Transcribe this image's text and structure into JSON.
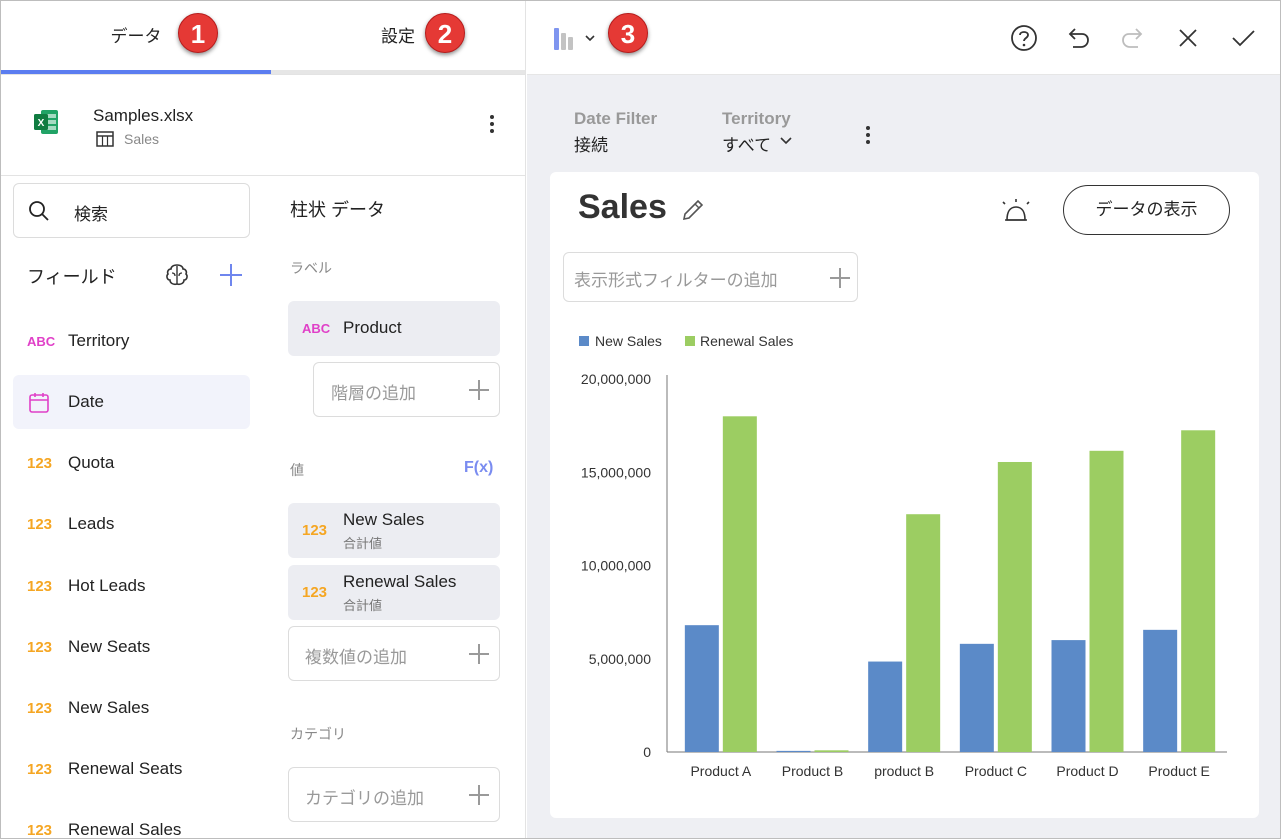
{
  "tabs": {
    "data": "データ",
    "settings": "設定"
  },
  "badges": [
    "1",
    "2",
    "3"
  ],
  "source": {
    "file": "Samples.xlsx",
    "sheet": "Sales"
  },
  "search": {
    "placeholder": "検索"
  },
  "fields": {
    "title": "フィールド",
    "items": [
      {
        "type": "ABC",
        "name": "Territory"
      },
      {
        "type": "date",
        "name": "Date"
      },
      {
        "type": "123",
        "name": "Quota"
      },
      {
        "type": "123",
        "name": "Leads"
      },
      {
        "type": "123",
        "name": "Hot Leads"
      },
      {
        "type": "123",
        "name": "New Seats"
      },
      {
        "type": "123",
        "name": "New Sales"
      },
      {
        "type": "123",
        "name": "Renewal Seats"
      },
      {
        "type": "123",
        "name": "Renewal Sales"
      }
    ]
  },
  "config": {
    "title": "柱状 データ",
    "label_section": "ラベル",
    "label_chip": {
      "type": "ABC",
      "name": "Product"
    },
    "add_hierarchy": "階層の追加",
    "value_section": "値",
    "fx": "F(x)",
    "values": [
      {
        "type": "123",
        "name": "New Sales",
        "agg": "合計値"
      },
      {
        "type": "123",
        "name": "Renewal Sales",
        "agg": "合計値"
      }
    ],
    "add_values": "複数値の追加",
    "category_section": "カテゴリ",
    "add_category": "カテゴリの追加"
  },
  "filters": {
    "date_label": "Date Filter",
    "date_value": "接続",
    "territory_label": "Territory",
    "territory_value": "すべて"
  },
  "card": {
    "title": "Sales",
    "show_data": "データの表示",
    "add_visual_filter": "表示形式フィルターの追加"
  },
  "colors": {
    "accent": "#5b7df0",
    "new_sales": "#5b8ac8",
    "renewal_sales": "#9ccd62",
    "badge": "#e53935"
  },
  "chart_data": {
    "type": "bar",
    "categories": [
      "Product A",
      "Product B",
      "product B",
      "Product C",
      "Product D",
      "Product E"
    ],
    "series": [
      {
        "name": "New Sales",
        "values": [
          6800000,
          60000,
          4850000,
          5800000,
          6000000,
          6550000
        ]
      },
      {
        "name": "Renewal Sales",
        "values": [
          18000000,
          90000,
          12750000,
          15550000,
          16150000,
          17250000
        ]
      }
    ],
    "y_ticks": [
      "20,000,000",
      "15,000,000",
      "10,000,000",
      "5,000,000",
      "0"
    ],
    "ylim": [
      0,
      20000000
    ],
    "legend_position": "top-left"
  }
}
